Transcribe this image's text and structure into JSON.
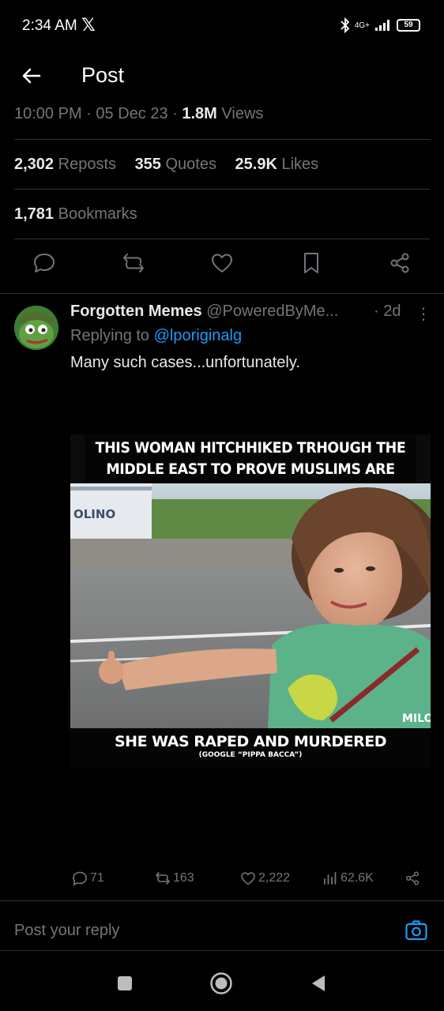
{
  "status_bar": {
    "time": "2:34 AM",
    "x_logo": "𝕏",
    "network": "4G+",
    "battery": "59"
  },
  "header": {
    "title": "Post"
  },
  "post_meta": {
    "time": "10:00 PM",
    "date": "05 Dec 23",
    "views_count": "1.8M",
    "views_label": "Views",
    "sep": "·"
  },
  "stats": {
    "reposts_count": "2,302",
    "reposts_label": "Reposts",
    "quotes_count": "355",
    "quotes_label": "Quotes",
    "likes_count": "25.9K",
    "likes_label": "Likes",
    "bookmarks_count": "1,781",
    "bookmarks_label": "Bookmarks"
  },
  "reply": {
    "author_name": "Forgotten Memes",
    "author_handle": "@PoweredByMe...",
    "time_ago": "· 2d",
    "more": "⋮",
    "replying_prefix": "Replying to",
    "replying_handle": "@lporiginalg",
    "text": "Many such cases...unfortunately.",
    "meme": {
      "top_line1": "THIS WOMAN HITCHHIKED TRHOUGH THE",
      "top_line2": "MIDDLE EAST TO PROVE MUSLIMS ARE PEACEFUL",
      "bottom_line1": "SHE WAS RAPED AND MURDERED",
      "bottom_line2": "(GOOGLE “PIPPA BACCA”)",
      "watermark": "MILO",
      "truck_text": "OLINO"
    },
    "engagement": {
      "replies": "71",
      "reposts": "163",
      "likes": "2,222",
      "views": "62.6K"
    }
  },
  "composer": {
    "placeholder": "Post your reply"
  },
  "colors": {
    "accent": "#1d9bf0",
    "muted": "#71767b",
    "text": "#e7e9ea",
    "divider": "#2f3336",
    "background": "#000000"
  }
}
